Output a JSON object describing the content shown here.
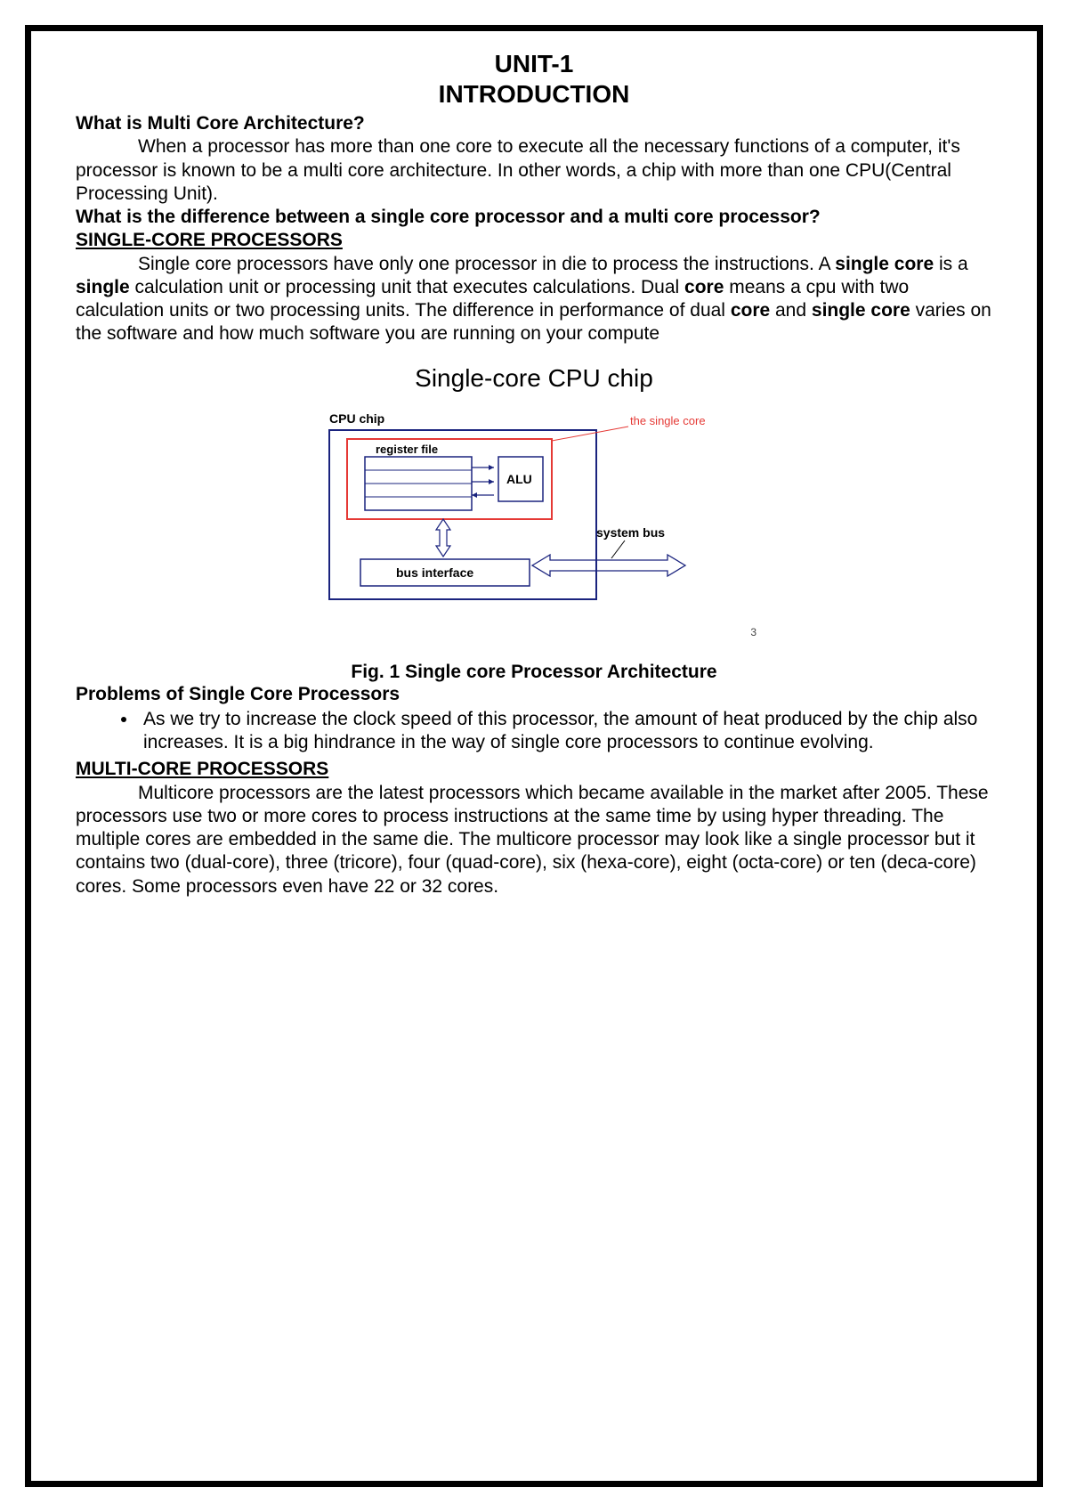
{
  "header": {
    "unit": "UNIT-1",
    "title": "INTRODUCTION"
  },
  "q1": {
    "question": "What is Multi Core Architecture?",
    "answer": "When a processor has more than one core to execute all the necessary functions of a computer, it's processor is known to be a multi core architecture. In other words, a chip with more than one CPU(Central Processing Unit)."
  },
  "q2": {
    "question": "What is the difference between a single core processor and a multi core processor?"
  },
  "single": {
    "heading": "SINGLE-CORE PROCESSORS",
    "p_before1": "Single core processors have only one processor in die to process the instructions. A ",
    "b1": "single core",
    "p_mid1": " is a ",
    "b2": "single",
    "p_mid2": " calculation unit or processing unit that executes calculations. Dual ",
    "b3": "core",
    "p_mid3": " means a cpu with two calculation units or two processing units. The difference in performance of dual ",
    "b4": "core",
    "p_mid4": " and ",
    "b5": "single core",
    "p_after": " varies on the software and how much software you are running on your compute"
  },
  "figure": {
    "title": "Single-core CPU chip",
    "labels": {
      "cpu_chip": "CPU chip",
      "register_file": "register file",
      "alu": "ALU",
      "bus_interface": "bus interface",
      "system_bus": "system bus",
      "single_core": "the single core"
    },
    "page_num": "3",
    "caption": "Fig. 1 Single core Processor Architecture"
  },
  "problems": {
    "heading": "Problems of Single Core Processors",
    "bullet1": "As we try to increase the clock speed of this processor, the amount of heat produced by the chip also increases. It is a big hindrance in the way of single core processors to continue evolving."
  },
  "multi": {
    "heading": "MULTI-CORE PROCESSORS",
    "p": "Multicore processors are the latest processors which became available in the market after 2005. These processors use two or more cores to process instructions at the same time by using hyper threading. The multiple cores are embedded in the same die. The multicore processor may look like a single processor but it contains two (dual-core), three (tricore), four (quad-core), six (hexa-core), eight (octa-core) or ten (deca-core) cores. Some processors even have 22 or 32 cores."
  }
}
